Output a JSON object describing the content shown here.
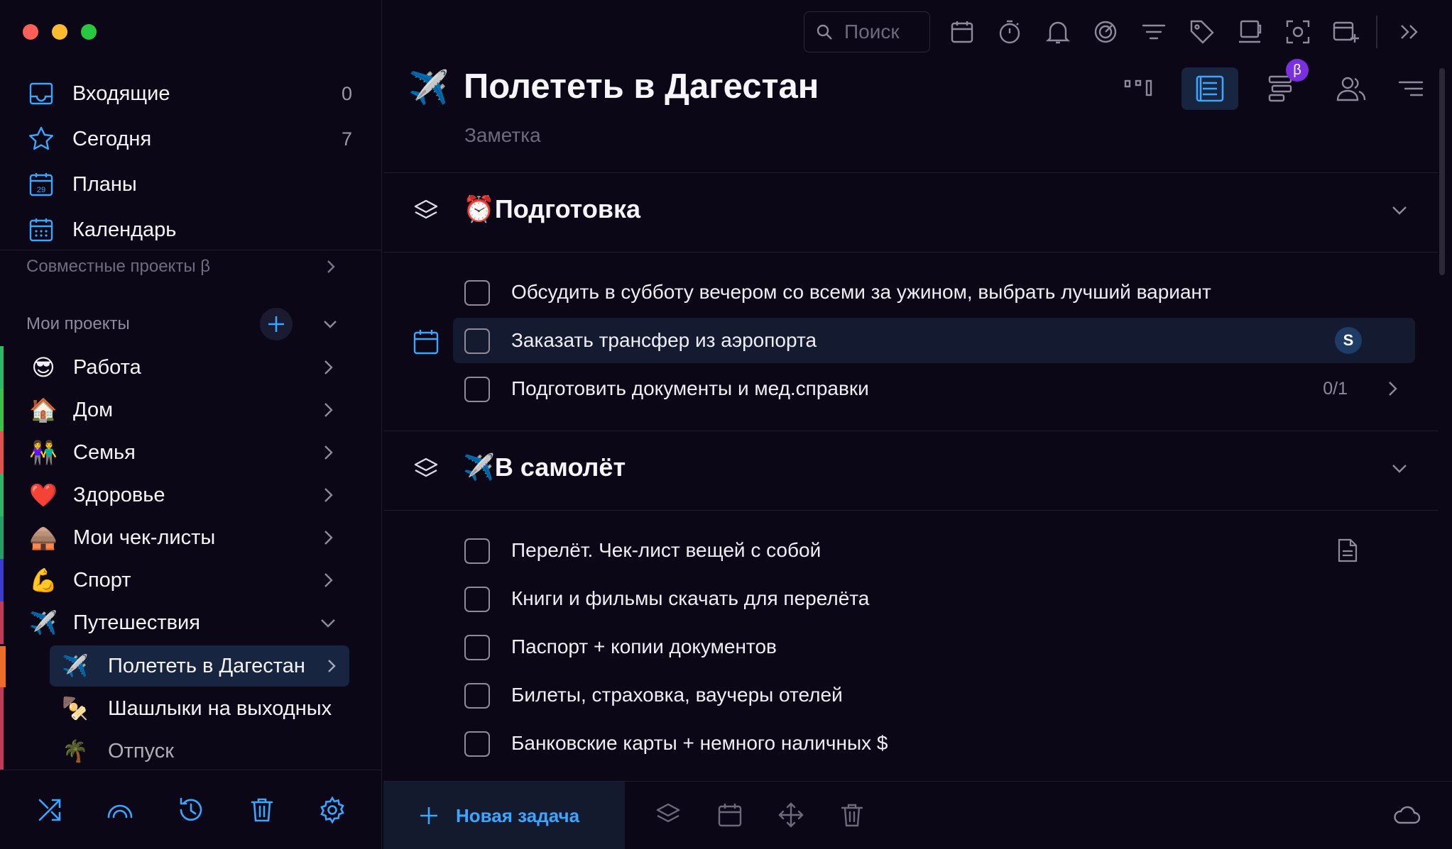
{
  "colors": {
    "accent": "#3aa6ff",
    "bg": "#0b0716",
    "active_bg": "#172541",
    "highlight_bg": "#141b30",
    "muted": "#6d6a7e"
  },
  "sidebar": {
    "nav": [
      {
        "label": "Входящие",
        "count": "0",
        "icon": "inbox-icon"
      },
      {
        "label": "Сегодня",
        "count": "7",
        "icon": "star-icon"
      },
      {
        "label": "Планы",
        "count": "",
        "icon": "calendar-29-icon"
      },
      {
        "label": "Календарь",
        "count": "",
        "icon": "calendar-grid-icon"
      }
    ],
    "shared_projects": "Совместные проекты β",
    "my_projects": "Мои проекты",
    "projects": [
      {
        "emoji": "😎",
        "label": "Работа",
        "color": "#2fb86a"
      },
      {
        "emoji": "🏠",
        "label": "Дом",
        "color": "#3fbf4c"
      },
      {
        "emoji": "👫",
        "label": "Семья",
        "color": "#e0524a"
      },
      {
        "emoji": "❤️",
        "label": "Здоровье",
        "color": "#34b36a"
      },
      {
        "emoji": "🛖",
        "label": "Мои чек-листы",
        "color": "#2a9e68"
      },
      {
        "emoji": "💪",
        "label": "Спорт",
        "color": "#3c3ad0"
      },
      {
        "emoji": "✈️",
        "label": "Путешествия",
        "color": "#c23a5a"
      }
    ],
    "subprojects": [
      {
        "emoji": "✈️",
        "label": "Полететь в Дагестан",
        "active": true
      },
      {
        "emoji": "🍢",
        "label": "Шашлыки на выходных",
        "active": false
      },
      {
        "emoji": "🌴",
        "label": "Отпуск",
        "active": false
      }
    ]
  },
  "toolbar": {
    "search_placeholder": "Поиск"
  },
  "page": {
    "emoji": "✈️",
    "title": "Полететь в Дагестан",
    "note": "Заметка",
    "beta": "β"
  },
  "sections": [
    {
      "emoji": "⏰",
      "title": "Подготовка",
      "tasks": [
        {
          "text": "Обсудить в субботу вечером со всеми за ужином, выбрать лучший вариант"
        },
        {
          "text": "Заказать трансфер из аэропорта",
          "avatar": "S"
        },
        {
          "text": "Подготовить документы и мед.справки",
          "progress": "0/1"
        }
      ]
    },
    {
      "emoji": "✈️",
      "title": "В самолёт",
      "tasks": [
        {
          "text": "Перелёт. Чек-лист вещей с собой"
        },
        {
          "text": "Книги и фильмы скачать для перелёта"
        },
        {
          "text": "Паспорт + копии документов"
        },
        {
          "text": "Билеты, страховка, ваучеры отелей"
        },
        {
          "text": "Банковские карты + немного наличных $"
        }
      ]
    }
  ],
  "bottom": {
    "new_task": "Новая задача"
  }
}
